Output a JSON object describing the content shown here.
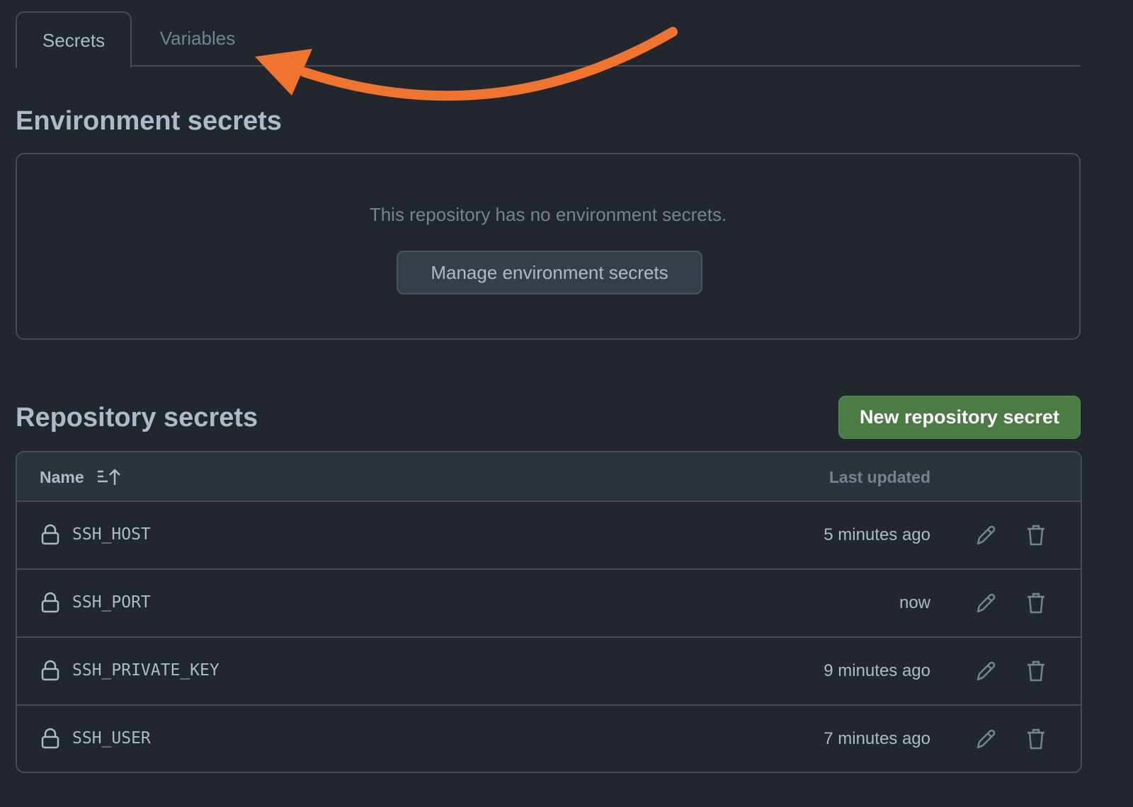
{
  "tabs": [
    {
      "label": "Secrets",
      "active": true
    },
    {
      "label": "Variables",
      "active": false
    }
  ],
  "environment": {
    "heading": "Environment secrets",
    "empty_text": "This repository has no environment secrets.",
    "manage_button": "Manage environment secrets"
  },
  "repository": {
    "heading": "Repository secrets",
    "new_button": "New repository secret",
    "columns": {
      "name": "Name",
      "updated": "Last updated"
    },
    "rows": [
      {
        "name": "SSH_HOST",
        "updated": "5 minutes ago"
      },
      {
        "name": "SSH_PORT",
        "updated": "now"
      },
      {
        "name": "SSH_PRIVATE_KEY",
        "updated": "9 minutes ago"
      },
      {
        "name": "SSH_USER",
        "updated": "7 minutes ago"
      }
    ]
  },
  "colors": {
    "accent_arrow": "#ee7430",
    "primary_button": "#4a7c44",
    "background": "#22272e"
  }
}
